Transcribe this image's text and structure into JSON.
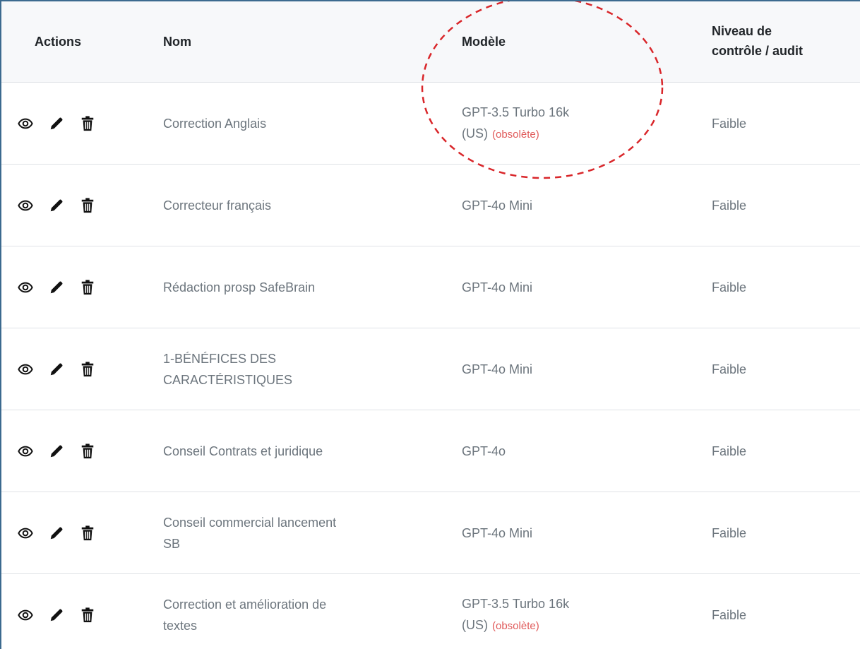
{
  "table": {
    "columns": {
      "actions": "Actions",
      "nom": "Nom",
      "modele": "Modèle",
      "niveau_line1": "Niveau de",
      "niveau_line2": "contrôle / audit"
    },
    "obsolete_label": "(obsolète)",
    "rows": [
      {
        "nom_line1": "Correction Anglais",
        "nom_line2": "",
        "modele_line1": "GPT-3.5 Turbo 16k",
        "modele_line2": "(US)",
        "obsolete": true,
        "niveau": "Faible"
      },
      {
        "nom_line1": "Correcteur français",
        "nom_line2": "",
        "modele_line1": "GPT-4o Mini",
        "modele_line2": "",
        "obsolete": false,
        "niveau": "Faible"
      },
      {
        "nom_line1": "Rédaction prosp SafeBrain",
        "nom_line2": "",
        "modele_line1": "GPT-4o Mini",
        "modele_line2": "",
        "obsolete": false,
        "niveau": "Faible"
      },
      {
        "nom_line1": "1-BÉNÉFICES DES",
        "nom_line2": "CARACTÉRISTIQUES",
        "modele_line1": "GPT-4o Mini",
        "modele_line2": "",
        "obsolete": false,
        "niveau": "Faible"
      },
      {
        "nom_line1": "Conseil Contrats et juridique",
        "nom_line2": "",
        "modele_line1": "GPT-4o",
        "modele_line2": "",
        "obsolete": false,
        "niveau": "Faible"
      },
      {
        "nom_line1": "Conseil commercial lancement",
        "nom_line2": "SB",
        "modele_line1": "GPT-4o Mini",
        "modele_line2": "",
        "obsolete": false,
        "niveau": "Faible"
      },
      {
        "nom_line1": "Correction et amélioration de",
        "nom_line2": "textes",
        "modele_line1": "GPT-3.5 Turbo 16k",
        "modele_line2": "(US)",
        "obsolete": true,
        "niveau": "Faible"
      }
    ],
    "row_icons": [
      "eye-icon",
      "pencil-icon",
      "trash-icon"
    ]
  },
  "colors": {
    "header_bg": "#f7f8fa",
    "text_muted": "#6c757d",
    "text_dark": "#212529",
    "obsolete": "#e05a5a",
    "annotation": "#d9262a",
    "frame_border": "#3c6a8f"
  }
}
